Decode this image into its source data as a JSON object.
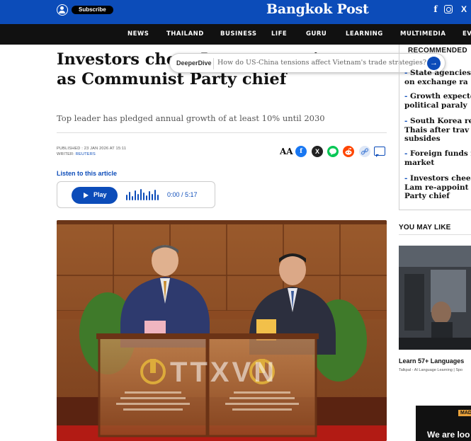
{
  "topbar": {
    "subscribe_label": "Subscribe",
    "logo": "Bangkok Post",
    "social": {
      "facebook": "f",
      "x": "X"
    }
  },
  "nav": {
    "items": [
      "NEWS",
      "THAILAND",
      "BUSINESS",
      "LIFE",
      "GURU",
      "LEARNING",
      "MULTIMEDIA",
      "EV"
    ]
  },
  "article": {
    "headline": "Investors cheer Lam re-appointment as Communist Party chief",
    "subheadline": "Top leader has pledged annual growth of at least 10% until 2030",
    "published": "PUBLISHED : 23 JAN 2026 AT 15:11",
    "writer_label": "WRITER: ",
    "writer_name": "REUTERS",
    "aa_label": "AA",
    "listen_label": "Listen to this article",
    "audio": {
      "play_label": "Play",
      "time": "0:00 / 5:17"
    }
  },
  "deeperdive": {
    "label": "DeeperDive",
    "placeholder": "How do US-China tensions affect Vietnam's trade strategies?"
  },
  "photo": {
    "watermark": "TTXVN"
  },
  "sidebar": {
    "recommended_title": "RECOMMENDED",
    "recommended": [
      "State agencies u\non exchange ra",
      "Growth expecte\npolitical paraly",
      "South Korea re\nThais after trav\nsubsides",
      "Foreign funds r\nmarket",
      "Investors cheer\nLam re-appoint\nParty chief"
    ],
    "you_may_like_title": "YOU MAY LIKE",
    "promo_title": "Learn 57+ Languages",
    "promo_source": "Talkpal - AI Language Learning | Spo",
    "ad_tag": "MAD",
    "ad_text": "We are loo"
  },
  "colors": {
    "brand_blue": "#0c4cb9",
    "nav_black": "#111111",
    "facebook": "#1877f2",
    "x": "#222222",
    "line": "#06c755",
    "reddit": "#ff4500",
    "link": "#5b8ddb"
  },
  "icons": {
    "share": [
      "facebook-icon",
      "x-icon",
      "line-icon",
      "reddit-icon",
      "link-icon"
    ]
  }
}
